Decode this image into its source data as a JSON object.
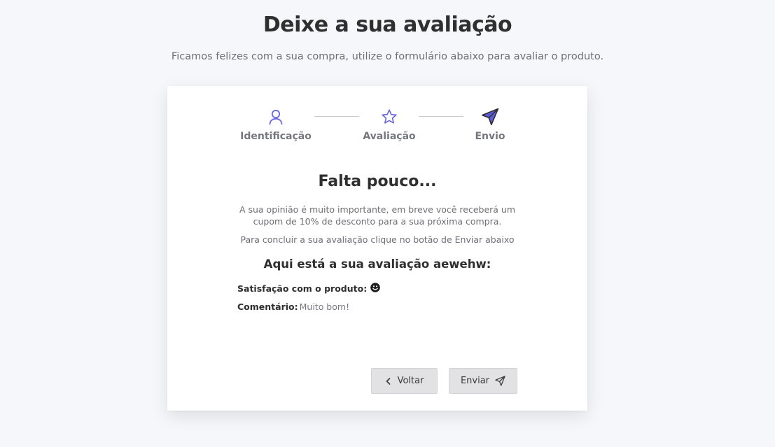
{
  "header": {
    "title": "Deixe a sua avaliação",
    "subtitle": "Ficamos felizes com a sua compra, utilize o formulário abaixo para avaliar o produto."
  },
  "steps": [
    {
      "label": "Identificação",
      "icon": "user-icon",
      "color": "#6a6ade"
    },
    {
      "label": "Avaliação",
      "icon": "star-icon",
      "color": "#6a6ade"
    },
    {
      "label": "Envio",
      "icon": "send-icon",
      "color": "#5b5bd6"
    }
  ],
  "summary": {
    "heading": "Falta pouco...",
    "paragraph1": "A sua opinião é muito importante, em breve você receberá um cupom de 10% de desconto para a sua próxima compra.",
    "paragraph2": "Para concluir a sua avaliação clique no botão de Enviar abaixo",
    "review_title": "Aqui está a sua avaliação aewehw:",
    "satisfaction_label": "Satisfação com o produto:",
    "satisfaction_icon": "smiley-icon",
    "comment_label": "Comentário:",
    "comment_value": "Muito bom!"
  },
  "actions": {
    "back_label": "Voltar",
    "send_label": "Enviar"
  }
}
